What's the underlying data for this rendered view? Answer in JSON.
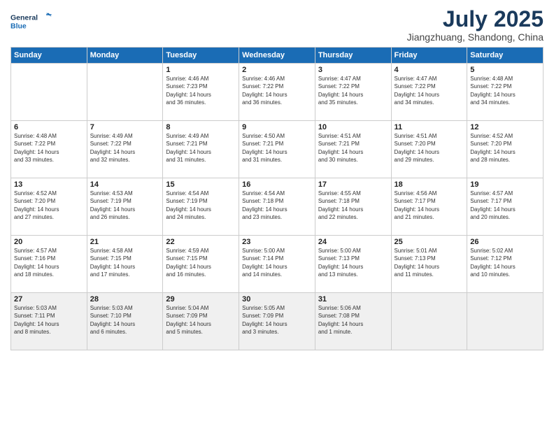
{
  "header": {
    "logo_line1": "General",
    "logo_line2": "Blue",
    "month": "July 2025",
    "location": "Jiangzhuang, Shandong, China"
  },
  "weekdays": [
    "Sunday",
    "Monday",
    "Tuesday",
    "Wednesday",
    "Thursday",
    "Friday",
    "Saturday"
  ],
  "weeks": [
    [
      {
        "day": "",
        "info": ""
      },
      {
        "day": "",
        "info": ""
      },
      {
        "day": "1",
        "info": "Sunrise: 4:46 AM\nSunset: 7:23 PM\nDaylight: 14 hours\nand 36 minutes."
      },
      {
        "day": "2",
        "info": "Sunrise: 4:46 AM\nSunset: 7:22 PM\nDaylight: 14 hours\nand 36 minutes."
      },
      {
        "day": "3",
        "info": "Sunrise: 4:47 AM\nSunset: 7:22 PM\nDaylight: 14 hours\nand 35 minutes."
      },
      {
        "day": "4",
        "info": "Sunrise: 4:47 AM\nSunset: 7:22 PM\nDaylight: 14 hours\nand 34 minutes."
      },
      {
        "day": "5",
        "info": "Sunrise: 4:48 AM\nSunset: 7:22 PM\nDaylight: 14 hours\nand 34 minutes."
      }
    ],
    [
      {
        "day": "6",
        "info": "Sunrise: 4:48 AM\nSunset: 7:22 PM\nDaylight: 14 hours\nand 33 minutes."
      },
      {
        "day": "7",
        "info": "Sunrise: 4:49 AM\nSunset: 7:22 PM\nDaylight: 14 hours\nand 32 minutes."
      },
      {
        "day": "8",
        "info": "Sunrise: 4:49 AM\nSunset: 7:21 PM\nDaylight: 14 hours\nand 31 minutes."
      },
      {
        "day": "9",
        "info": "Sunrise: 4:50 AM\nSunset: 7:21 PM\nDaylight: 14 hours\nand 31 minutes."
      },
      {
        "day": "10",
        "info": "Sunrise: 4:51 AM\nSunset: 7:21 PM\nDaylight: 14 hours\nand 30 minutes."
      },
      {
        "day": "11",
        "info": "Sunrise: 4:51 AM\nSunset: 7:20 PM\nDaylight: 14 hours\nand 29 minutes."
      },
      {
        "day": "12",
        "info": "Sunrise: 4:52 AM\nSunset: 7:20 PM\nDaylight: 14 hours\nand 28 minutes."
      }
    ],
    [
      {
        "day": "13",
        "info": "Sunrise: 4:52 AM\nSunset: 7:20 PM\nDaylight: 14 hours\nand 27 minutes."
      },
      {
        "day": "14",
        "info": "Sunrise: 4:53 AM\nSunset: 7:19 PM\nDaylight: 14 hours\nand 26 minutes."
      },
      {
        "day": "15",
        "info": "Sunrise: 4:54 AM\nSunset: 7:19 PM\nDaylight: 14 hours\nand 24 minutes."
      },
      {
        "day": "16",
        "info": "Sunrise: 4:54 AM\nSunset: 7:18 PM\nDaylight: 14 hours\nand 23 minutes."
      },
      {
        "day": "17",
        "info": "Sunrise: 4:55 AM\nSunset: 7:18 PM\nDaylight: 14 hours\nand 22 minutes."
      },
      {
        "day": "18",
        "info": "Sunrise: 4:56 AM\nSunset: 7:17 PM\nDaylight: 14 hours\nand 21 minutes."
      },
      {
        "day": "19",
        "info": "Sunrise: 4:57 AM\nSunset: 7:17 PM\nDaylight: 14 hours\nand 20 minutes."
      }
    ],
    [
      {
        "day": "20",
        "info": "Sunrise: 4:57 AM\nSunset: 7:16 PM\nDaylight: 14 hours\nand 18 minutes."
      },
      {
        "day": "21",
        "info": "Sunrise: 4:58 AM\nSunset: 7:15 PM\nDaylight: 14 hours\nand 17 minutes."
      },
      {
        "day": "22",
        "info": "Sunrise: 4:59 AM\nSunset: 7:15 PM\nDaylight: 14 hours\nand 16 minutes."
      },
      {
        "day": "23",
        "info": "Sunrise: 5:00 AM\nSunset: 7:14 PM\nDaylight: 14 hours\nand 14 minutes."
      },
      {
        "day": "24",
        "info": "Sunrise: 5:00 AM\nSunset: 7:13 PM\nDaylight: 14 hours\nand 13 minutes."
      },
      {
        "day": "25",
        "info": "Sunrise: 5:01 AM\nSunset: 7:13 PM\nDaylight: 14 hours\nand 11 minutes."
      },
      {
        "day": "26",
        "info": "Sunrise: 5:02 AM\nSunset: 7:12 PM\nDaylight: 14 hours\nand 10 minutes."
      }
    ],
    [
      {
        "day": "27",
        "info": "Sunrise: 5:03 AM\nSunset: 7:11 PM\nDaylight: 14 hours\nand 8 minutes."
      },
      {
        "day": "28",
        "info": "Sunrise: 5:03 AM\nSunset: 7:10 PM\nDaylight: 14 hours\nand 6 minutes."
      },
      {
        "day": "29",
        "info": "Sunrise: 5:04 AM\nSunset: 7:09 PM\nDaylight: 14 hours\nand 5 minutes."
      },
      {
        "day": "30",
        "info": "Sunrise: 5:05 AM\nSunset: 7:09 PM\nDaylight: 14 hours\nand 3 minutes."
      },
      {
        "day": "31",
        "info": "Sunrise: 5:06 AM\nSunset: 7:08 PM\nDaylight: 14 hours\nand 1 minute."
      },
      {
        "day": "",
        "info": ""
      },
      {
        "day": "",
        "info": ""
      }
    ]
  ]
}
